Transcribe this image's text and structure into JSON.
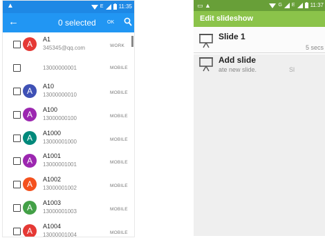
{
  "left": {
    "status_time": "11:35",
    "status_net": "E",
    "toolbar": {
      "title": "0 selected",
      "ok": "OK"
    },
    "colors": {
      "status": "#1e88e5",
      "toolbar": "#2196f3"
    },
    "contacts": [
      {
        "name": "A1",
        "detail": "345345@qq.com",
        "type": "WORK",
        "initial": "A",
        "color": "#e53935"
      },
      {
        "name": "",
        "detail": "13000000001",
        "type": "MOBILE",
        "initial": "",
        "color": ""
      },
      {
        "name": "A10",
        "detail": "13000000010",
        "type": "MOBILE",
        "initial": "A",
        "color": "#3f51b5"
      },
      {
        "name": "A100",
        "detail": "13000000100",
        "type": "MOBILE",
        "initial": "A",
        "color": "#9c27b0"
      },
      {
        "name": "A1000",
        "detail": "13000001000",
        "type": "MOBILE",
        "initial": "A",
        "color": "#00897b"
      },
      {
        "name": "A1001",
        "detail": "13000001001",
        "type": "MOBILE",
        "initial": "A",
        "color": "#9c27b0"
      },
      {
        "name": "A1002",
        "detail": "13000001002",
        "type": "MOBILE",
        "initial": "A",
        "color": "#f4511e"
      },
      {
        "name": "A1003",
        "detail": "13000001003",
        "type": "MOBILE",
        "initial": "A",
        "color": "#43a047"
      },
      {
        "name": "A1004",
        "detail": "13000001004",
        "type": "MOBILE",
        "initial": "A",
        "color": "#e53935"
      }
    ]
  },
  "right": {
    "status_time": "11:37",
    "status_net": "G",
    "status_net2": "E",
    "toolbar": {
      "title": "Edit slideshow"
    },
    "colors": {
      "status": "#689f38",
      "toolbar": "#8bc34a"
    },
    "slides": [
      {
        "title": "Slide 1",
        "duration": "5 secs"
      },
      {
        "title": "Add slide",
        "subtitle": "ate new slide.",
        "extra": "Sl"
      }
    ]
  }
}
